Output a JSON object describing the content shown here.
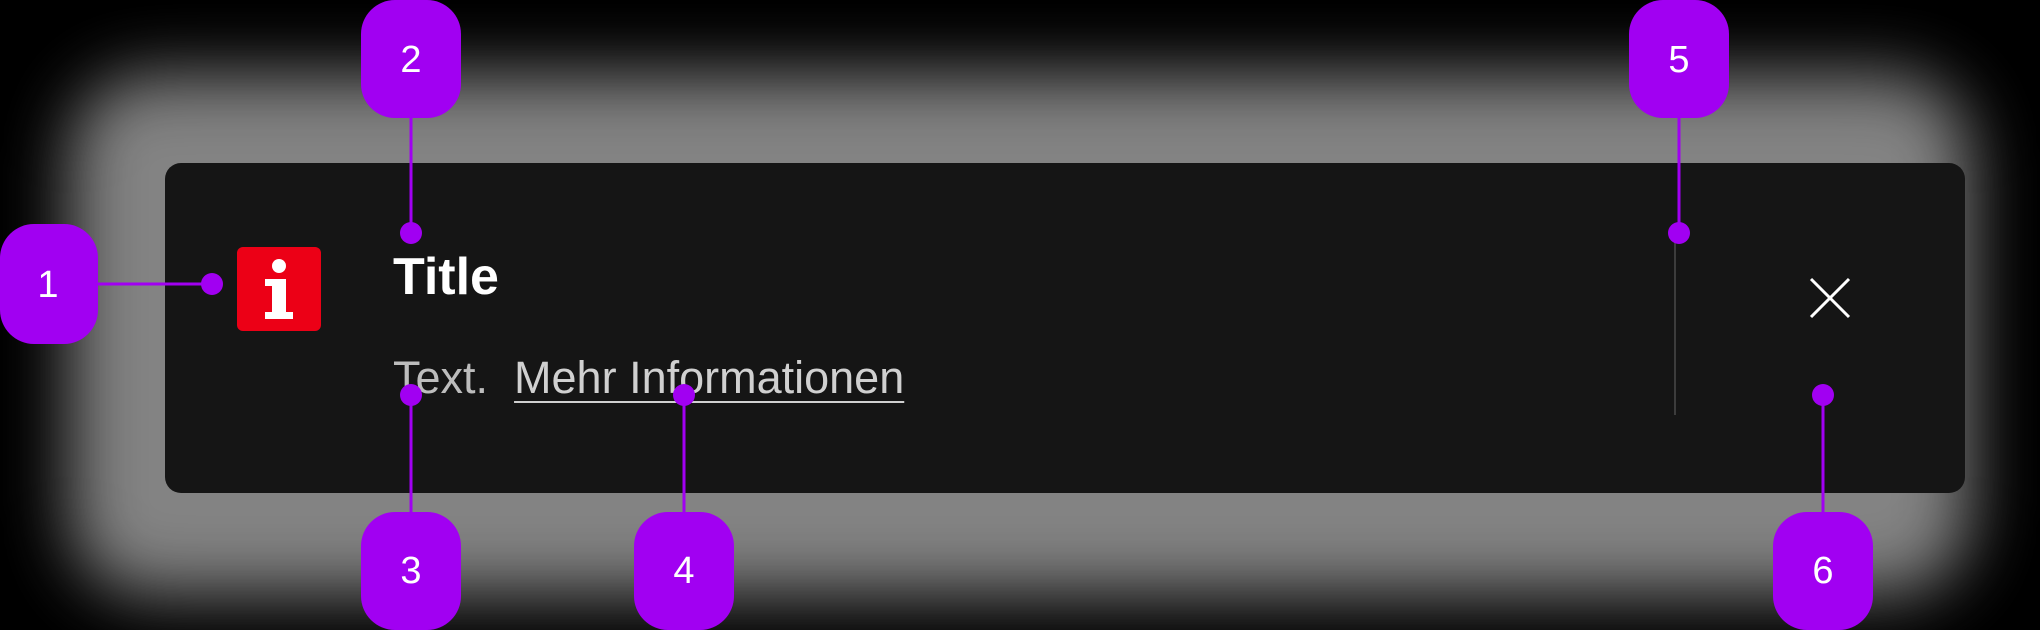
{
  "notification": {
    "title": "Title",
    "text": "Text.",
    "link_label": "Mehr Informationen",
    "icon": "info-icon",
    "close_icon": "close-icon"
  },
  "annotations": [
    {
      "number": "1",
      "target": "info-icon"
    },
    {
      "number": "2",
      "target": "title"
    },
    {
      "number": "3",
      "target": "text"
    },
    {
      "number": "4",
      "target": "link"
    },
    {
      "number": "5",
      "target": "divider"
    },
    {
      "number": "6",
      "target": "close-button"
    }
  ],
  "colors": {
    "background": "#000000",
    "card": "#151515",
    "icon_bg": "#ec0016",
    "annotation": "#a100f2",
    "title": "#ffffff",
    "text": "#bdbdbd",
    "divider": "#3c3c3c"
  }
}
